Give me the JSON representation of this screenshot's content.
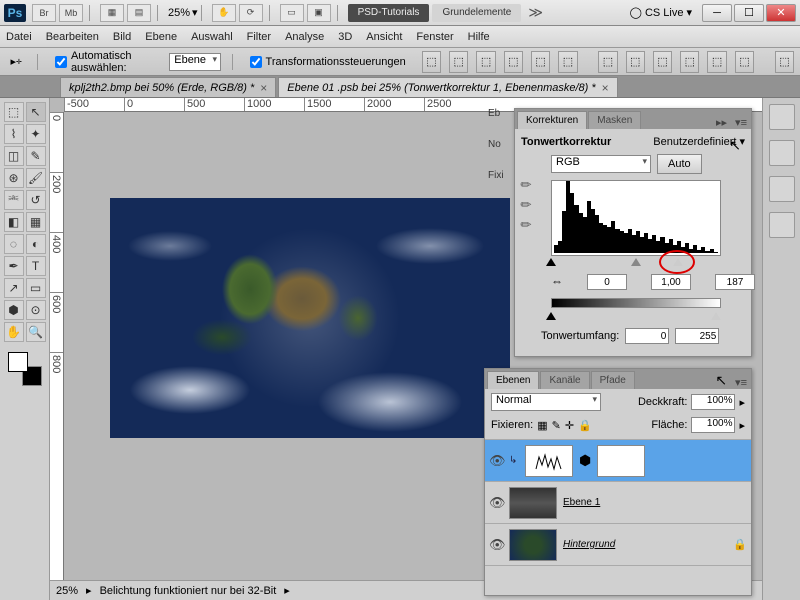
{
  "title": {
    "zoom": "25%",
    "tab1": "PSD-Tutorials",
    "tab2": "Grundelemente",
    "cslive": "CS Live"
  },
  "menu": [
    "Datei",
    "Bearbeiten",
    "Bild",
    "Ebene",
    "Auswahl",
    "Filter",
    "Analyse",
    "3D",
    "Ansicht",
    "Fenster",
    "Hilfe"
  ],
  "opt": {
    "auto": "Automatisch auswählen:",
    "layer": "Ebene",
    "trans": "Transformationssteuerungen"
  },
  "doc": {
    "t1": "kplj2th2.bmp bei 50% (Erde, RGB/8) *",
    "t2": "Ebene 01 .psb bei 25% (Tonwertkorrektur 1, Ebenenmaske/8) *"
  },
  "rulerH": [
    "-500",
    "0",
    "500",
    "1000",
    "1500",
    "2000",
    "2500"
  ],
  "rulerV": [
    "0",
    "200",
    "400",
    "600",
    "800"
  ],
  "status": {
    "zoom": "25%",
    "msg": "Belichtung funktioniert nur bei 32-Bit"
  },
  "occl": {
    "eb": "Eb",
    "no": "No",
    "fix": "Fixi"
  },
  "korr": {
    "tabs": [
      "Korrekturen",
      "Masken"
    ],
    "title": "Tonwertkorrektur",
    "preset": "Benutzerdefiniert",
    "channel": "RGB",
    "auto": "Auto",
    "in": [
      "0",
      "1,00",
      "187"
    ],
    "outlbl": "Tonwertumfang:",
    "out": [
      "0",
      "255"
    ]
  },
  "eben": {
    "tabs": [
      "Ebenen",
      "Kanäle",
      "Pfade"
    ],
    "mode": "Normal",
    "opacityLbl": "Deckkraft:",
    "opacity": "100%",
    "lockLbl": "Fixieren:",
    "fillLbl": "Fläche:",
    "fill": "100%",
    "layers": [
      {
        "name": "",
        "type": "adj"
      },
      {
        "name": "Ebene 1",
        "type": "img"
      },
      {
        "name": "Hintergrund",
        "type": "bg"
      }
    ]
  },
  "hist": [
    8,
    12,
    42,
    72,
    60,
    48,
    40,
    36,
    52,
    44,
    38,
    30,
    28,
    26,
    32,
    24,
    22,
    20,
    24,
    18,
    22,
    16,
    20,
    14,
    18,
    12,
    16,
    10,
    14,
    8,
    12,
    6,
    10,
    4,
    8,
    3,
    6,
    2,
    4,
    1
  ]
}
